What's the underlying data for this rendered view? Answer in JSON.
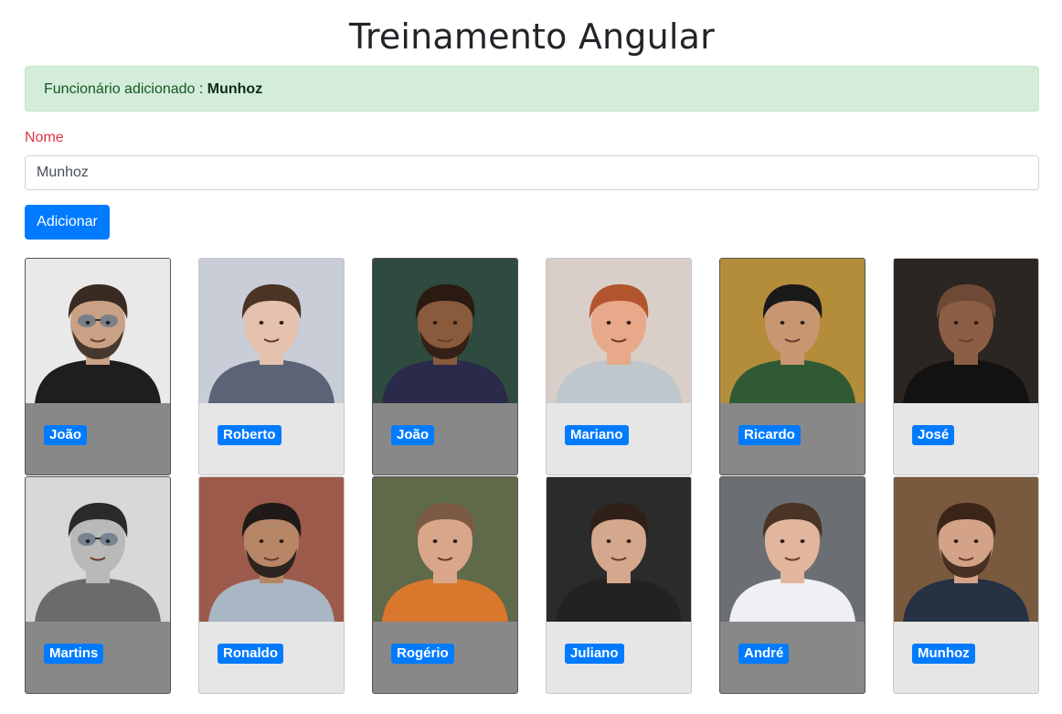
{
  "page": {
    "title": "Treinamento Angular"
  },
  "alert": {
    "text": "Funcionário adicionado : ",
    "name": "Munhoz"
  },
  "form": {
    "label": "Nome",
    "input_value": "Munhoz",
    "button_label": "Adicionar"
  },
  "colors": {
    "primary": "#007bff",
    "alert_bg": "#d4edda",
    "label_red": "#dc3545",
    "card_dark": "#888888",
    "card_light": "#e6e6e6"
  },
  "employees": [
    {
      "name": "João",
      "theme": "dark",
      "bg": "#e9e9e9",
      "skin": "#c9a184",
      "hair": "#3a2b22",
      "shirt": "#1e1e1e",
      "beard": true,
      "glasses": true
    },
    {
      "name": "Roberto",
      "theme": "light",
      "bg": "#c9cdd8",
      "skin": "#e4c2ad",
      "hair": "#4b3424",
      "shirt": "#5a6476",
      "beard": false,
      "glasses": false
    },
    {
      "name": "João",
      "theme": "dark",
      "bg": "#2f4a3e",
      "skin": "#8a5a3c",
      "hair": "#2a1a12",
      "shirt": "#2a2a4a",
      "beard": true,
      "glasses": false
    },
    {
      "name": "Mariano",
      "theme": "light",
      "bg": "#d9cfc8",
      "skin": "#e8a98a",
      "hair": "#b2552e",
      "shirt": "#bfc6cc",
      "beard": false,
      "glasses": false
    },
    {
      "name": "Ricardo",
      "theme": "dark",
      "bg": "#b38d3a",
      "skin": "#c99672",
      "hair": "#1a1a1a",
      "shirt": "#2f5a34",
      "beard": false,
      "glasses": false
    },
    {
      "name": "José",
      "theme": "light",
      "bg": "#2c2623",
      "skin": "#8c5e45",
      "hair": "#6e4a36",
      "shirt": "#121212",
      "beard": false,
      "glasses": false
    },
    {
      "name": "Martins",
      "theme": "dark",
      "bg": "#d8d8d8",
      "skin": "#b9b9b9",
      "hair": "#2a2a2a",
      "shirt": "#6b6b6b",
      "beard": false,
      "glasses": true
    },
    {
      "name": "Ronaldo",
      "theme": "light",
      "bg": "#9c5a4a",
      "skin": "#b78666",
      "hair": "#1f1a17",
      "shirt": "#a9b6c4",
      "beard": true,
      "glasses": false
    },
    {
      "name": "Rogério",
      "theme": "dark",
      "bg": "#5e6a4a",
      "skin": "#d9a68a",
      "hair": "#7b5a44",
      "shirt": "#d9772c",
      "beard": false,
      "glasses": false
    },
    {
      "name": "Juliano",
      "theme": "light",
      "bg": "#2b2b2b",
      "skin": "#d4a88d",
      "hair": "#2f2118",
      "shirt": "#222222",
      "beard": false,
      "glasses": false
    },
    {
      "name": "André",
      "theme": "dark",
      "bg": "#6b6f74",
      "skin": "#e1b69c",
      "hair": "#4a3426",
      "shirt": "#eef0f4",
      "beard": false,
      "glasses": false
    },
    {
      "name": "Munhoz",
      "theme": "light",
      "bg": "#7a5a3e",
      "skin": "#d4a387",
      "hair": "#3a2518",
      "shirt": "#243244",
      "beard": true,
      "glasses": false
    }
  ]
}
